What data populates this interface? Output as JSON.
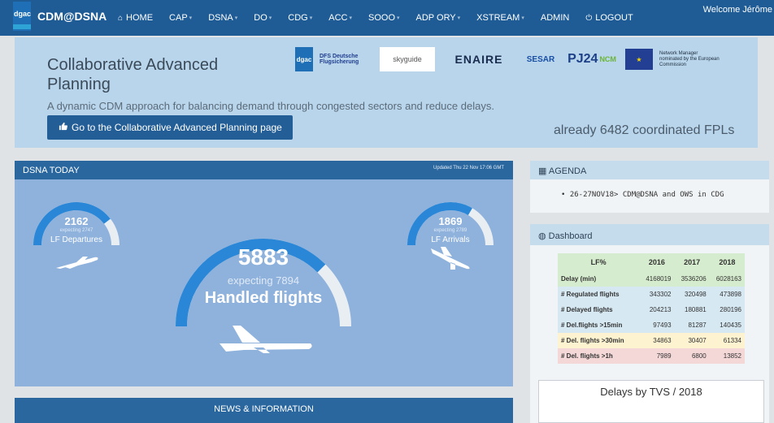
{
  "colors": {
    "navbar": "#1f5c96",
    "banner": "#b8d5ec",
    "panel_header": "#2a679f",
    "panel_body": "#8fb2dc",
    "gauge_fill": "#2a86d6",
    "gauge_track": "#e9eef3"
  },
  "navbar": {
    "brand_logo_text": "dgac",
    "brand_logo_sub": "DSNA",
    "brand": "CDM@DSNA",
    "items": [
      {
        "label": "HOME",
        "icon": "home-icon",
        "caret": false
      },
      {
        "label": "CAP",
        "caret": true
      },
      {
        "label": "DSNA",
        "caret": true
      },
      {
        "label": "DO",
        "caret": true
      },
      {
        "label": "CDG",
        "caret": true
      },
      {
        "label": "ACC",
        "caret": true
      },
      {
        "label": "SOOO",
        "caret": true
      },
      {
        "label": "ADP ORY",
        "caret": true
      },
      {
        "label": "XSTREAM",
        "caret": true
      },
      {
        "label": "ADMIN",
        "caret": false
      },
      {
        "label": "LOGOUT",
        "icon": "power-icon",
        "caret": false
      }
    ],
    "welcome": "Welcome Jérôme"
  },
  "banner": {
    "title": "Collaborative Advanced Planning",
    "subtitle": "A dynamic CDM approach for balancing demand through congested sectors and reduce delays.",
    "button": "Go to the Collaborative Advanced Planning page",
    "coordinated": "already 6482 coordinated FPLs",
    "logos": {
      "dgac": "dgac",
      "dfs": "DFS Deutsche Flugsicherung",
      "skyguide": "skyguide",
      "enaire": "ENAIRE",
      "sesar": "SESAR",
      "pj24": "PJ24",
      "pj24_sub": "NCM",
      "nm": "Network Manager nominated by the European Commission"
    }
  },
  "today": {
    "title": "DSNA TODAY",
    "updated": "Updated Thu 22 Nov 17:06 GMT",
    "departures": {
      "value": "2162",
      "expecting": "expecting 2747",
      "label": "LF Departures",
      "fill": 0.79
    },
    "handled": {
      "value": "5883",
      "expecting": "expecting 7894",
      "label": "Handled flights",
      "fill": 0.75
    },
    "arrivals": {
      "value": "1869",
      "expecting": "expecting 2789",
      "label": "LF Arrivals",
      "fill": 0.67
    }
  },
  "agenda": {
    "title": "AGENDA",
    "items": [
      "26-27NOV18> CDM@DSNA and OWS in CDG"
    ]
  },
  "dashboard": {
    "title": "Dashboard",
    "headers": [
      "LF%",
      "2016",
      "2017",
      "2018"
    ],
    "rows": [
      {
        "label": "Delay (min)",
        "values": [
          "4168019",
          "3536206",
          "6028163"
        ],
        "tone": "green"
      },
      {
        "label": "# Regulated flights",
        "values": [
          "343302",
          "320498",
          "473898"
        ],
        "tone": "blue"
      },
      {
        "label": "# Delayed flights",
        "values": [
          "204213",
          "180881",
          "280196"
        ],
        "tone": "blue"
      },
      {
        "label": "# Del.flights >15min",
        "values": [
          "97493",
          "81287",
          "140435"
        ],
        "tone": "blue"
      },
      {
        "label": "# Del. flights >30min",
        "values": [
          "34863",
          "30407",
          "61334"
        ],
        "tone": "yellow"
      },
      {
        "label": "# Del. flights >1h",
        "values": [
          "7989",
          "6800",
          "13852"
        ],
        "tone": "red"
      }
    ],
    "delays_title": "Delays by TVS / 2018"
  },
  "news": {
    "title": "NEWS & INFORMATION"
  }
}
